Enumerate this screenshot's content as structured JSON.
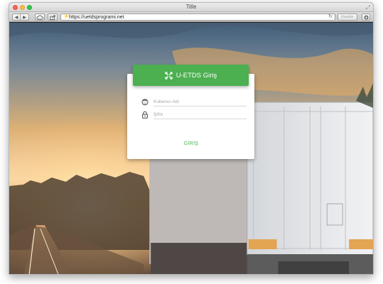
{
  "window": {
    "title": "Title"
  },
  "toolbar": {
    "url": "https://uetdsprogrami.net",
    "reader_label": "Reader"
  },
  "login": {
    "header_title": "U-ETDS Giriş",
    "username_placeholder": "Kullanıcı Adı",
    "password_placeholder": "Şifre",
    "submit_label": "GİRİŞ"
  },
  "icons": {
    "logo": "uetds-logo-icon",
    "user": "user-face-icon",
    "password": "lock-icon",
    "back": "back-arrow-icon",
    "forward": "forward-arrow-icon",
    "cloud": "cloud-icon",
    "share": "share-icon",
    "secure": "secure-icon",
    "reload": "reload-icon",
    "download": "download-icon"
  },
  "colors": {
    "accent": "#4caf50",
    "card": "#ffffff",
    "traffic_close": "#fc605b",
    "traffic_min": "#fdbc40",
    "traffic_max": "#34c84a"
  }
}
